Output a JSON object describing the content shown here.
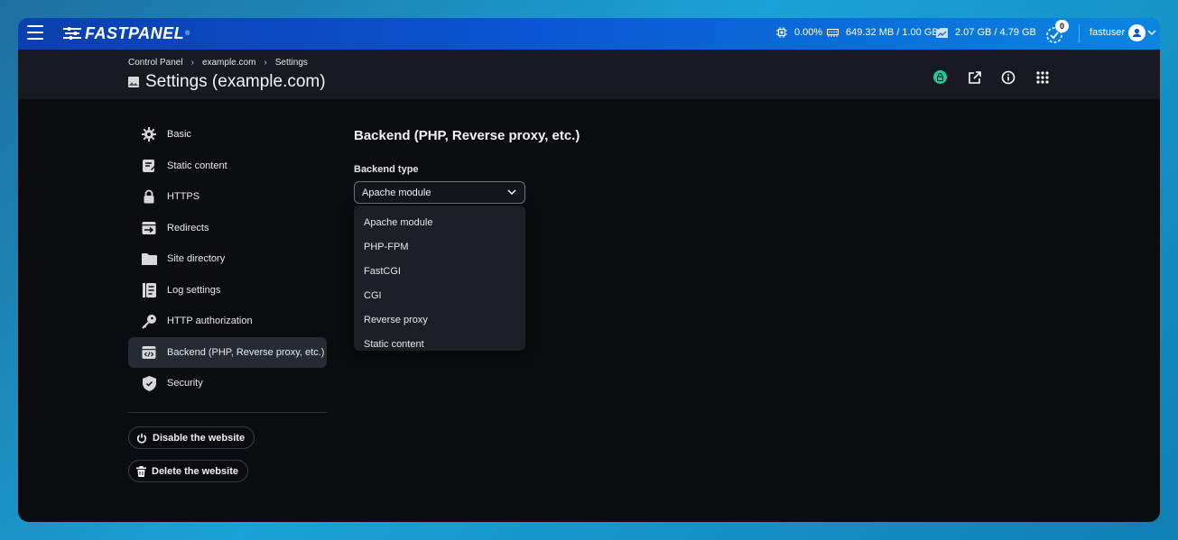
{
  "topbar": {
    "logo": "FASTPANEL",
    "logo_reg": "®",
    "cpu": "0.00%",
    "ram": "649.32 MB / 1.00 GB",
    "disk": "2.07 GB / 4.79 GB",
    "tasks_count": "0",
    "username": "fastuser"
  },
  "breadcrumb": {
    "items": [
      "Control Panel",
      "example.com",
      "Settings"
    ],
    "separator": "›"
  },
  "page": {
    "title": "Settings (example.com)"
  },
  "sidebar": {
    "items": [
      {
        "label": "Basic",
        "icon": "gear-icon"
      },
      {
        "label": "Static content",
        "icon": "document-icon"
      },
      {
        "label": "HTTPS",
        "icon": "lock-icon"
      },
      {
        "label": "Redirects",
        "icon": "redirect-icon"
      },
      {
        "label": "Site directory",
        "icon": "folder-icon"
      },
      {
        "label": "Log settings",
        "icon": "log-icon"
      },
      {
        "label": "HTTP authorization",
        "icon": "key-icon"
      },
      {
        "label": "Backend (PHP, Reverse proxy, etc.)",
        "icon": "code-icon",
        "active": true
      },
      {
        "label": "Security",
        "icon": "shield-icon"
      }
    ],
    "disable_label": "Disable the website",
    "delete_label": "Delete the website"
  },
  "main": {
    "section_title": "Backend (PHP, Reverse proxy, etc.)",
    "backend_type_label": "Backend type",
    "backend_type_value": "Apache module",
    "options": [
      "Apache module",
      "PHP-FPM",
      "FastCGI",
      "CGI",
      "Reverse proxy",
      "Static content"
    ]
  },
  "colors": {
    "topbar_start": "#0a3fae",
    "topbar_end": "#0a86e0",
    "background": "#0b0c10",
    "header_bg": "#181a21",
    "active_item": "#262a33",
    "ssl_badge": "#20c997"
  }
}
